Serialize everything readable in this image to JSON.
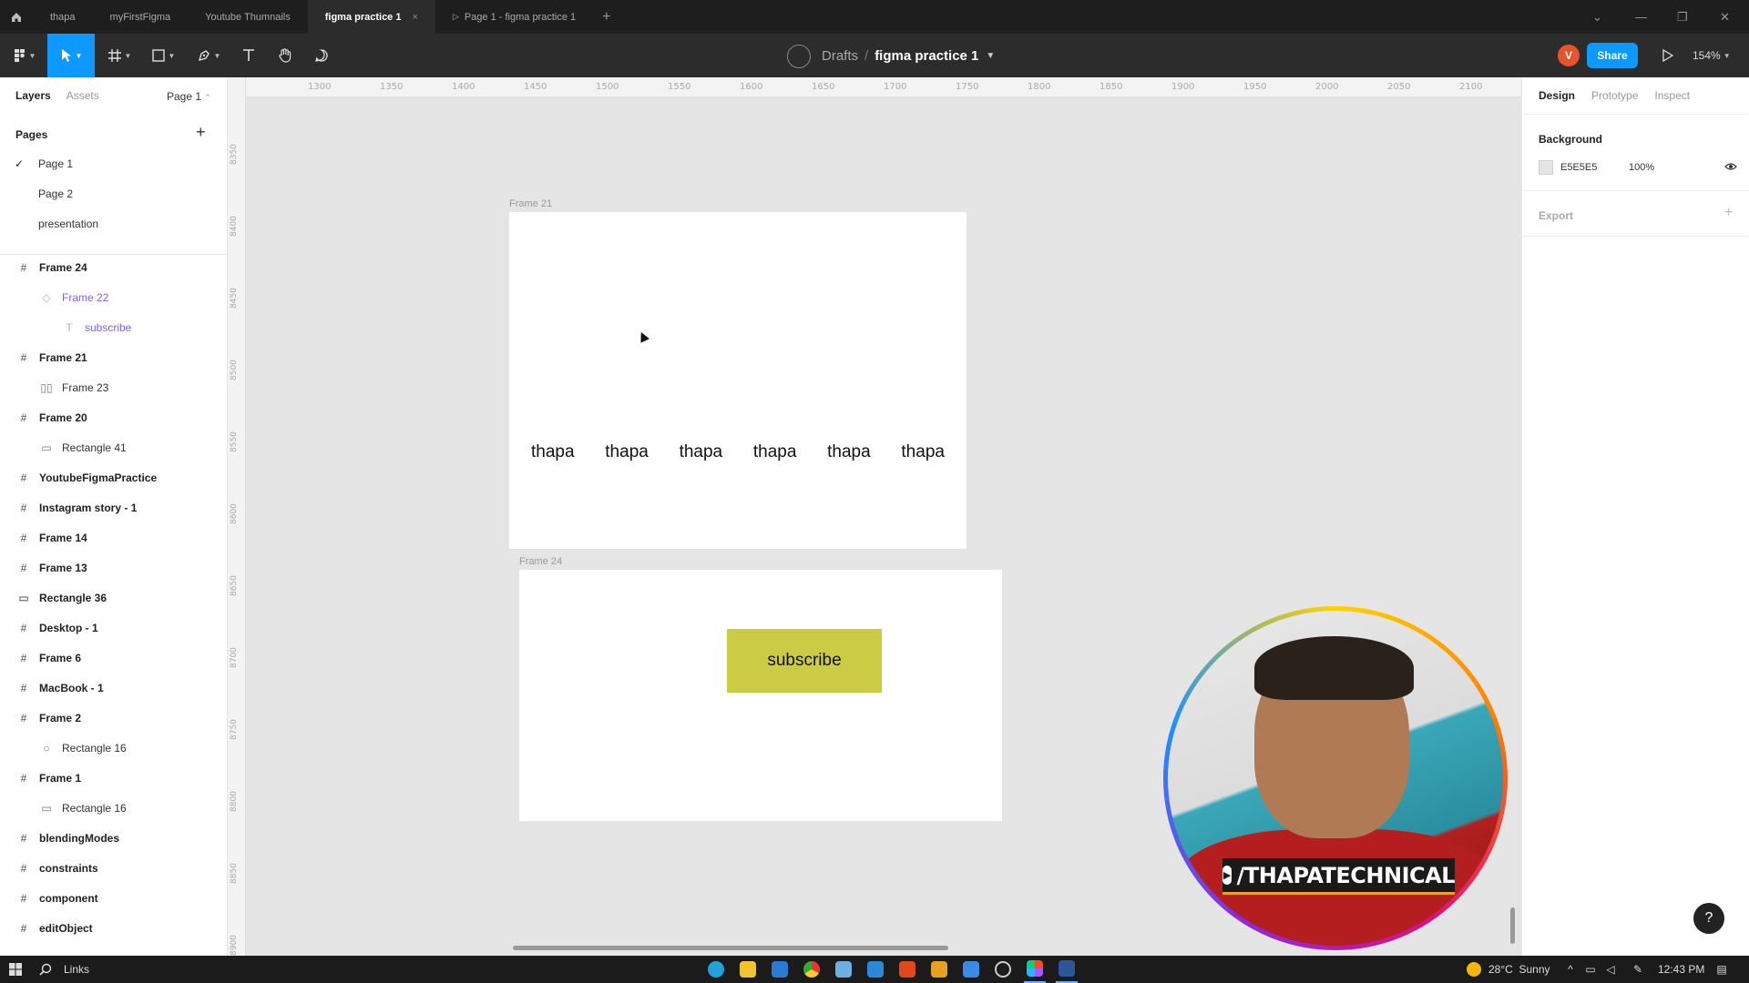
{
  "titlebar": {
    "tabs": [
      {
        "label": "thapa",
        "active": false
      },
      {
        "label": "myFirstFigma",
        "active": false
      },
      {
        "label": "Youtube Thumnails",
        "active": false
      },
      {
        "label": "figma practice 1",
        "active": true
      },
      {
        "label": "Page 1 - figma practice 1",
        "active": false
      }
    ],
    "close_glyph": "×",
    "add_glyph": "+"
  },
  "toolbar": {
    "breadcrumb_drafts": "Drafts",
    "breadcrumb_sep": "/",
    "file_name": "figma practice 1",
    "avatar_letter": "V",
    "share_label": "Share",
    "zoom": "154%",
    "icons": [
      "figma-menu-icon",
      "move-tool-icon",
      "frame-tool-icon",
      "shape-tool-icon",
      "pen-tool-icon",
      "text-tool-icon",
      "hand-tool-icon",
      "comment-tool-icon",
      "present-icon"
    ]
  },
  "left_panel": {
    "tab_layers": "Layers",
    "tab_assets": "Assets",
    "current_page": "Page 1",
    "pages_heading": "Pages",
    "pages": [
      {
        "label": "Page 1",
        "checked": true
      },
      {
        "label": "Page 2",
        "checked": false
      },
      {
        "label": "presentation",
        "checked": false
      }
    ],
    "layers": [
      {
        "label": "Frame 24",
        "icon": "frame-icon",
        "depth": 0
      },
      {
        "label": "Frame 22",
        "icon": "component-icon",
        "depth": 1,
        "selected": true
      },
      {
        "label": "subscribe",
        "icon": "text-icon",
        "depth": 2,
        "selected": true
      },
      {
        "label": "Frame 21",
        "icon": "frame-icon",
        "depth": 0
      },
      {
        "label": "Frame 23",
        "icon": "autolayout-icon",
        "depth": 1
      },
      {
        "label": "Frame 20",
        "icon": "frame-icon",
        "depth": 0
      },
      {
        "label": "Rectangle 41",
        "icon": "rectangle-icon",
        "depth": 1
      },
      {
        "label": "YoutubeFigmaPractice",
        "icon": "frame-icon",
        "depth": 0
      },
      {
        "label": "Instagram story - 1",
        "icon": "frame-icon",
        "depth": 0
      },
      {
        "label": "Frame 14",
        "icon": "frame-icon",
        "depth": 0
      },
      {
        "label": "Frame 13",
        "icon": "frame-icon",
        "depth": 0
      },
      {
        "label": "Rectangle 36",
        "icon": "rectangle-icon",
        "depth": 0
      },
      {
        "label": "Desktop - 1",
        "icon": "frame-icon",
        "depth": 0
      },
      {
        "label": "Frame 6",
        "icon": "frame-icon",
        "depth": 0
      },
      {
        "label": "MacBook - 1",
        "icon": "frame-icon",
        "depth": 0
      },
      {
        "label": "Frame 2",
        "icon": "frame-icon",
        "depth": 0
      },
      {
        "label": "Rectangle 16",
        "icon": "ellipse-icon",
        "depth": 1
      },
      {
        "label": "Frame 1",
        "icon": "frame-icon",
        "depth": 0
      },
      {
        "label": "Rectangle 16",
        "icon": "rectangle-icon",
        "depth": 1
      },
      {
        "label": "blendingModes",
        "icon": "frame-icon",
        "depth": 0
      },
      {
        "label": "constraints",
        "icon": "frame-icon",
        "depth": 0
      },
      {
        "label": "component",
        "icon": "frame-icon",
        "depth": 0
      },
      {
        "label": "editObject",
        "icon": "frame-icon",
        "depth": 0
      }
    ]
  },
  "rulers": {
    "top": [
      "1300",
      "1350",
      "1400",
      "1450",
      "1500",
      "1550",
      "1600",
      "1650",
      "1700",
      "1750",
      "1800",
      "1850",
      "1900",
      "1950",
      "2000",
      "2050",
      "2100"
    ],
    "left": [
      "8350",
      "8400",
      "8450",
      "8500",
      "8550",
      "8600",
      "8650",
      "8700",
      "8750",
      "8800",
      "8850",
      "8900"
    ]
  },
  "canvas": {
    "frame21_label": "Frame 21",
    "frame21_texts": [
      "thapa",
      "thapa",
      "thapa",
      "thapa",
      "thapa",
      "thapa"
    ],
    "frame24_label": "Frame 24",
    "subscribe_label": "subscribe",
    "subscribe_color": "#cccc44"
  },
  "webcam": {
    "banner_text": "/THAPATECHNICAL"
  },
  "right_panel": {
    "tab_design": "Design",
    "tab_prototype": "Prototype",
    "tab_inspect": "Inspect",
    "background_heading": "Background",
    "background_hex": "E5E5E5",
    "background_opacity": "100%",
    "export_heading": "Export",
    "help_glyph": "?"
  },
  "taskbar": {
    "search_label": "Links",
    "weather": "28°C  Sunny",
    "time": "12:43 PM"
  }
}
